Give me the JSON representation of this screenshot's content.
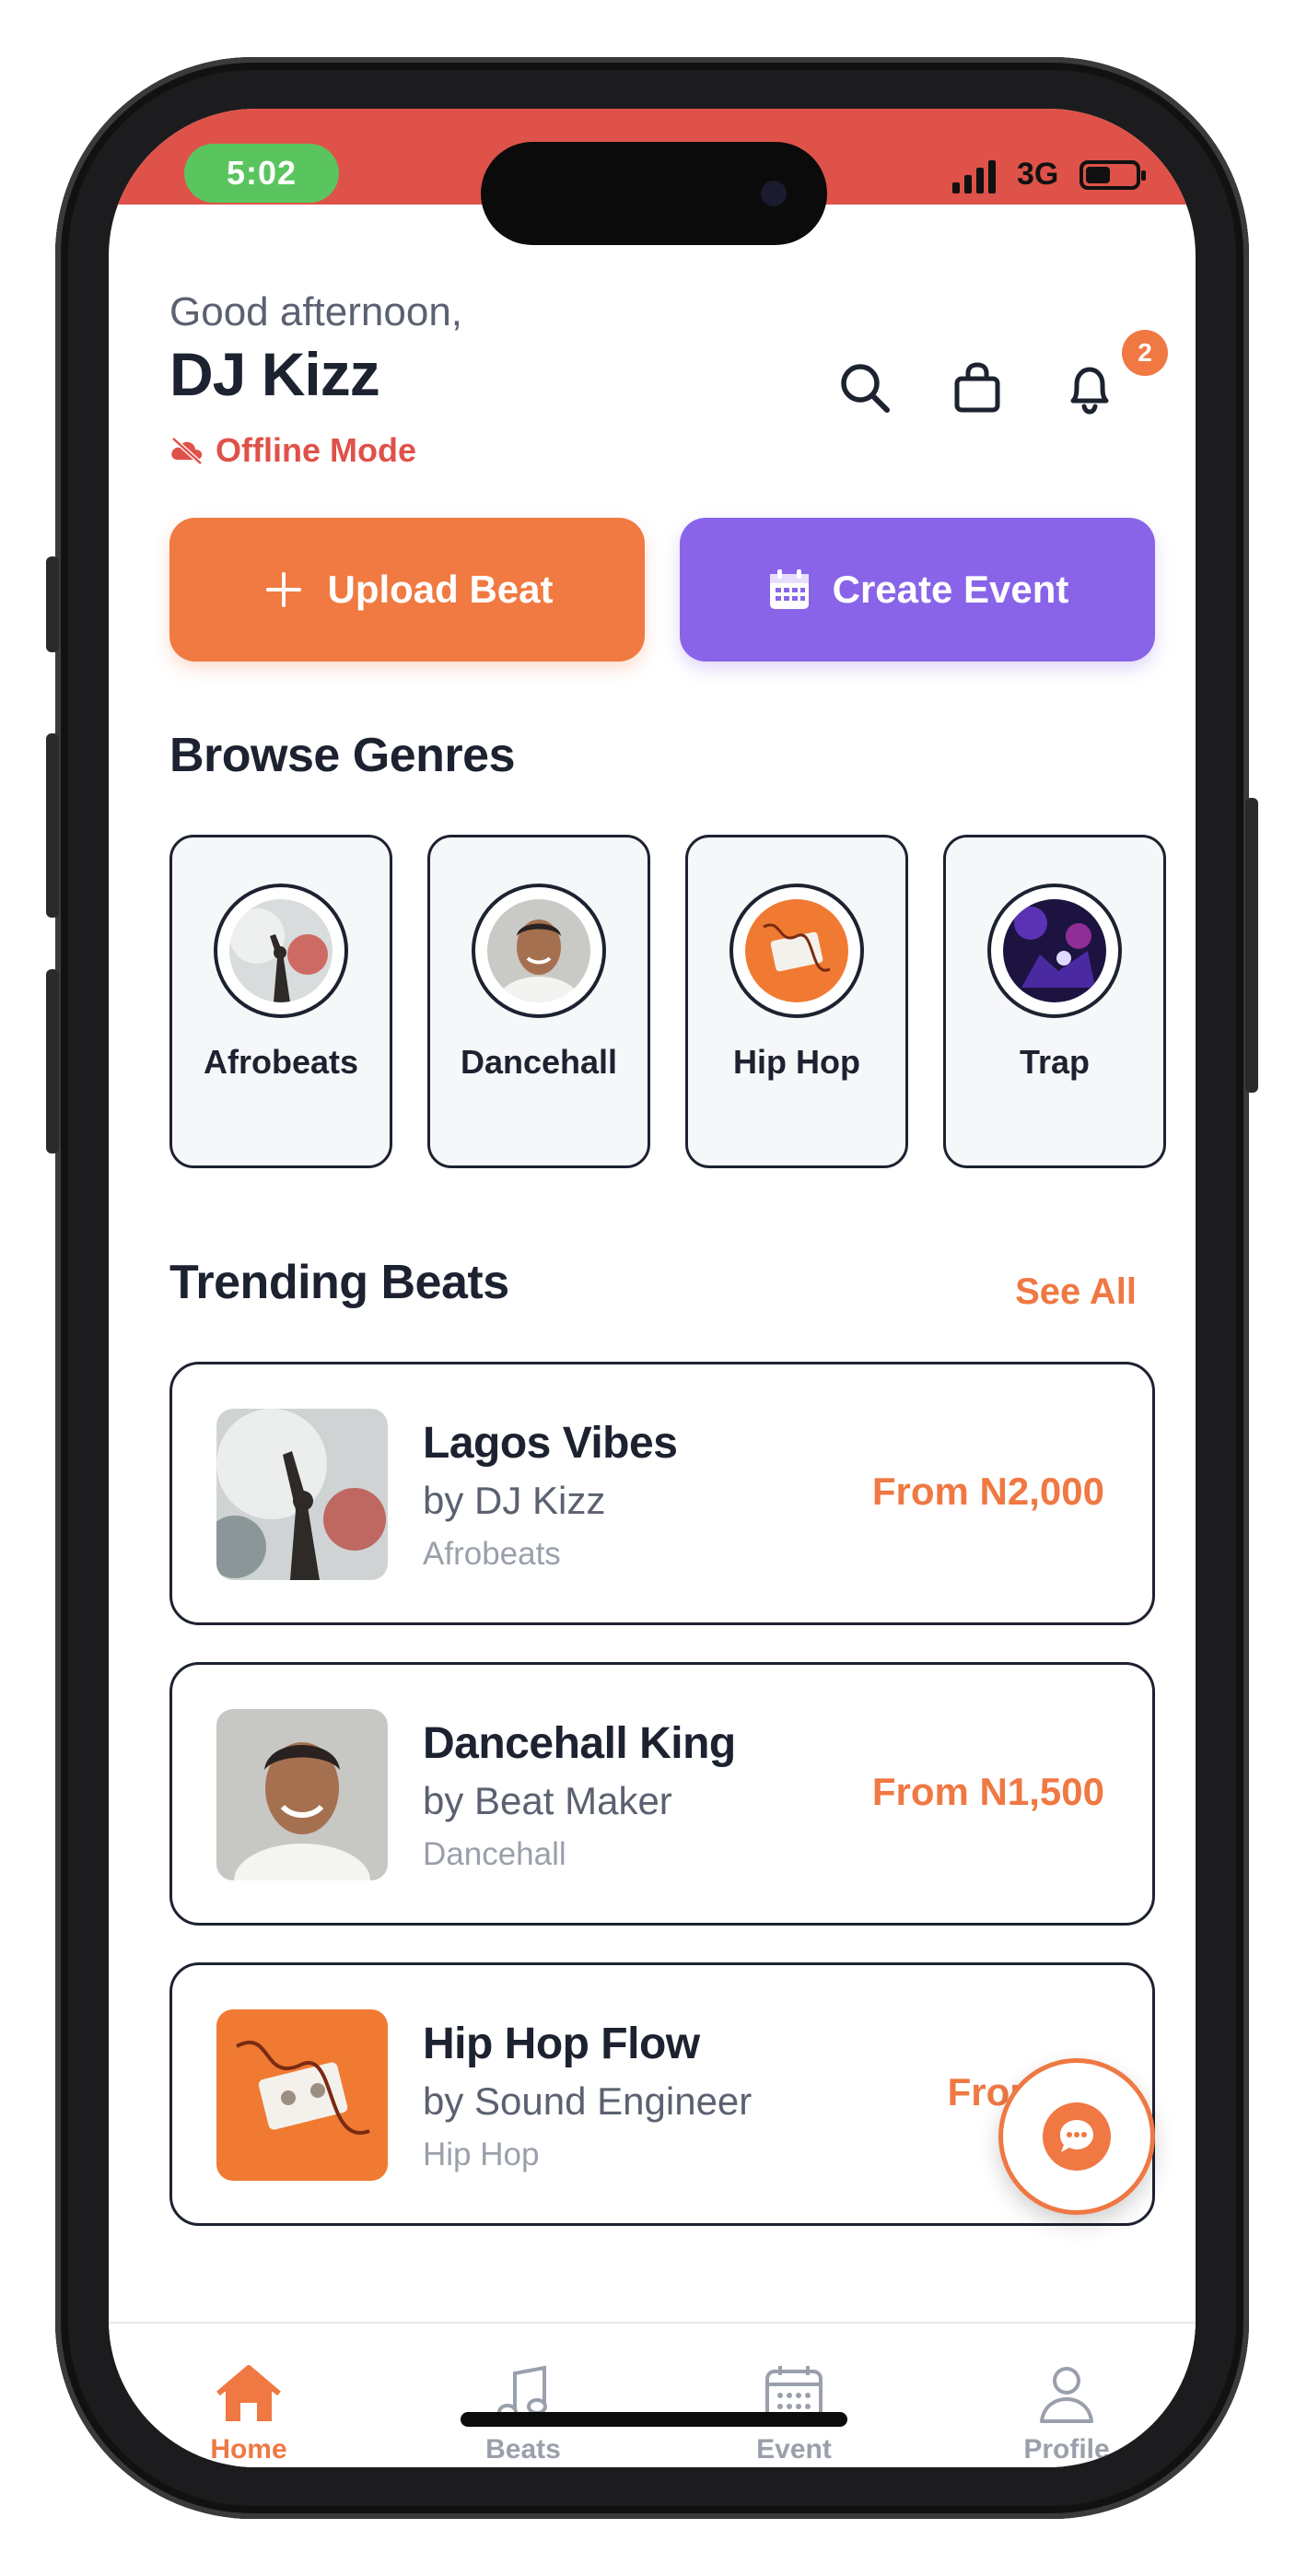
{
  "status_bar": {
    "time": "5:02",
    "network": "3G"
  },
  "header": {
    "greeting": "Good afternoon,",
    "username": "DJ Kizz",
    "mode": "Offline Mode",
    "notification_count": "2",
    "icons": [
      "search-icon",
      "shopping-bag-icon",
      "bell-icon"
    ]
  },
  "actions": {
    "upload_label": "Upload Beat",
    "event_label": "Create Event"
  },
  "genres": {
    "title": "Browse Genres",
    "items": [
      {
        "label": "Afrobeats",
        "image": "afrobeats-thumbnail"
      },
      {
        "label": "Dancehall",
        "image": "dancehall-thumbnail"
      },
      {
        "label": "Hip Hop",
        "image": "hip-hop-thumbnail"
      },
      {
        "label": "Trap",
        "image": "trap-thumbnail"
      }
    ]
  },
  "trending": {
    "title": "Trending Beats",
    "see_all": "See All",
    "items": [
      {
        "title": "Lagos Vibes",
        "artist": "by DJ Kizz",
        "genre": "Afrobeats",
        "price": "From N2,000"
      },
      {
        "title": "Dancehall King",
        "artist": "by Beat Maker",
        "genre": "Dancehall",
        "price": "From N1,500"
      },
      {
        "title": "Hip Hop Flow",
        "artist": "by Sound Engineer",
        "genre": "Hip Hop",
        "price": "From N2"
      }
    ]
  },
  "bottom_nav": {
    "items": [
      {
        "label": "Home",
        "icon": "home-icon",
        "active": true
      },
      {
        "label": "Beats",
        "icon": "music-note-icon",
        "active": false
      },
      {
        "label": "Event",
        "icon": "calendar-icon",
        "active": false
      },
      {
        "label": "Profile",
        "icon": "user-icon",
        "active": false
      }
    ]
  },
  "colors": {
    "accent_orange": "#ef7843",
    "accent_purple": "#8964e8",
    "status_red": "#df5249",
    "text_dark": "#1d2230"
  }
}
